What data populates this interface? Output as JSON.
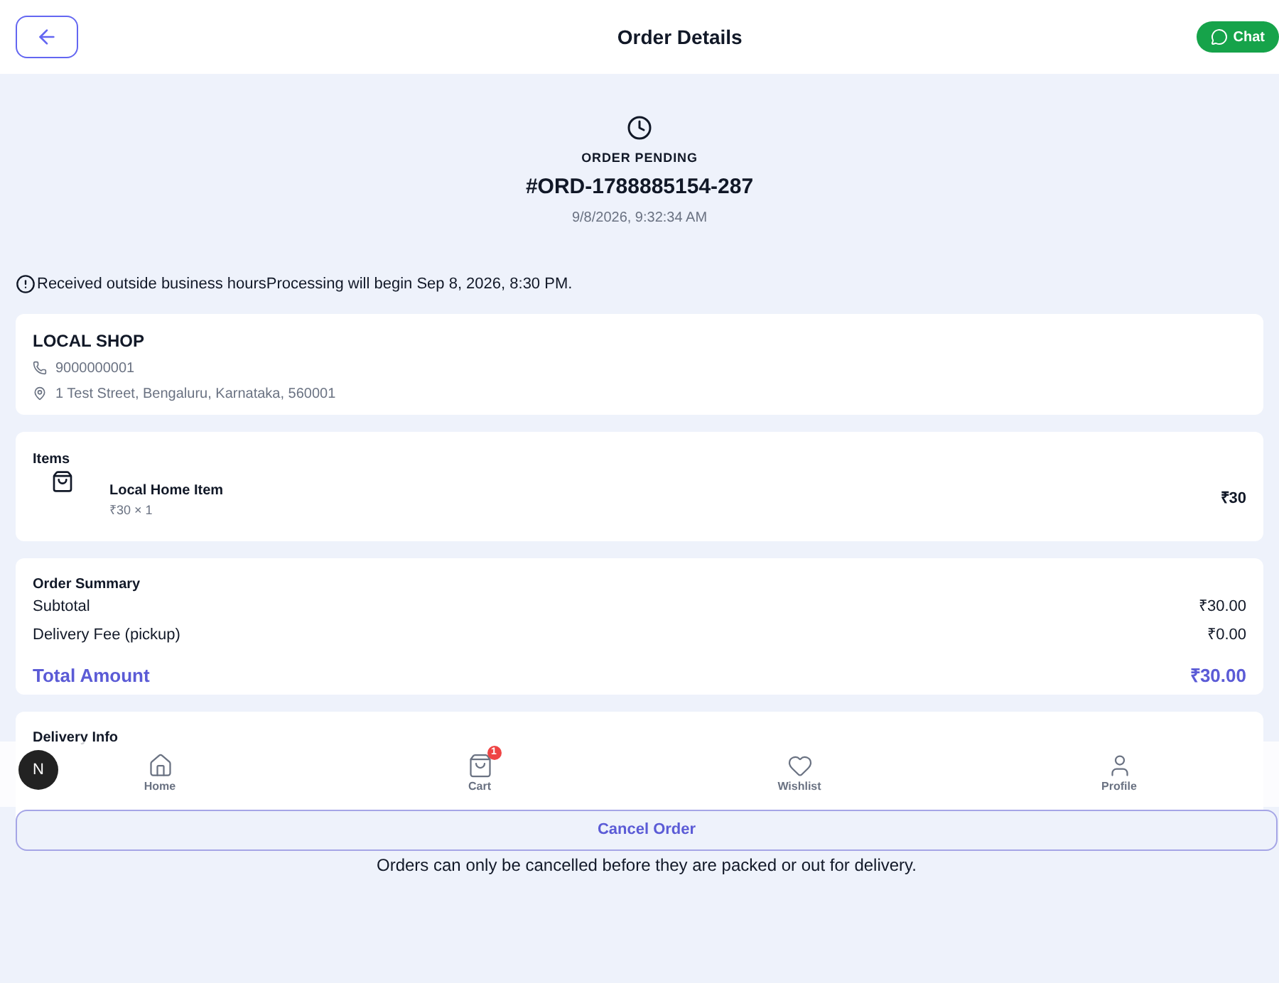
{
  "header": {
    "title": "Order Details",
    "chat_label": "Chat"
  },
  "status": {
    "label": "ORDER PENDING",
    "order_id": "#ORD-1788885154-287",
    "date": "9/8/2026, 9:32:34 AM"
  },
  "notice": "Received outside business hoursProcessing will begin Sep 8, 2026, 8:30 PM.",
  "shop": {
    "name": "LOCAL SHOP",
    "phone": "9000000001",
    "address": "1 Test Street, Bengaluru, Karnataka, 560001"
  },
  "items": {
    "title": "Items",
    "rows": [
      {
        "name": "Local Home Item",
        "qty": "₹30 × 1",
        "price": "₹30"
      }
    ]
  },
  "summary": {
    "title": "Order Summary",
    "rows": [
      {
        "label": "Subtotal",
        "value": "₹30.00"
      },
      {
        "label": "Delivery Fee (pickup)",
        "value": "₹0.00"
      }
    ],
    "total_label": "Total Amount",
    "total_value": "₹30.00"
  },
  "delivery": {
    "title": "Delivery Info"
  },
  "nav": [
    {
      "label": "Home",
      "kind": "home"
    },
    {
      "label": "Cart",
      "kind": "cart",
      "badge": "1"
    },
    {
      "label": "Wishlist",
      "kind": "wishlist"
    },
    {
      "label": "Profile",
      "kind": "profile"
    }
  ],
  "dev_badge": "N",
  "cancel": {
    "label": "Cancel Order",
    "note": "Orders can only be cancelled before they are packed or out for delivery."
  }
}
